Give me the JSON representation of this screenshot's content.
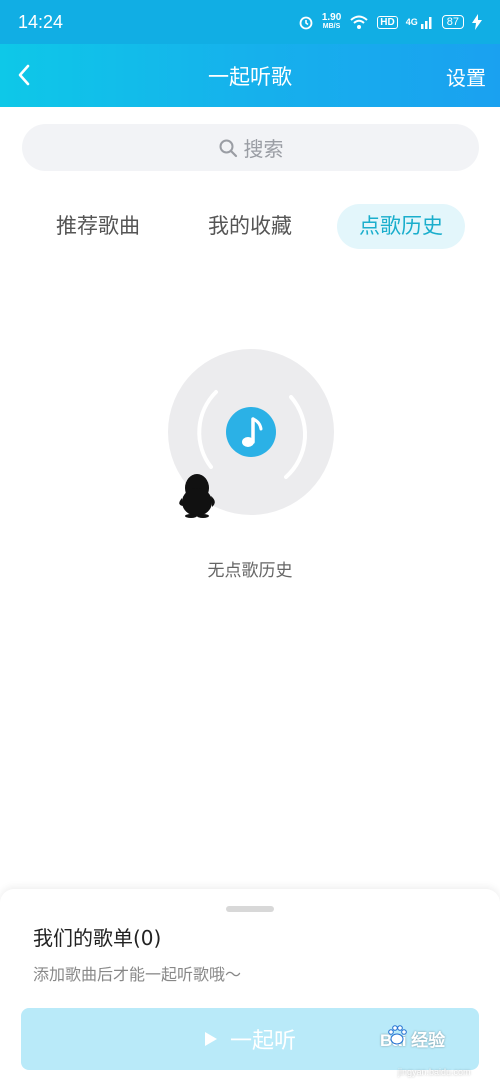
{
  "status_bar": {
    "time": "14:24",
    "speed_value": "1.90",
    "speed_unit": "MB/S",
    "hd_label": "HD",
    "network_label": "4G",
    "battery": "87"
  },
  "nav": {
    "title": "一起听歌",
    "settings_label": "设置",
    "back_icon": "chevron-left-icon"
  },
  "search": {
    "placeholder": "搜索",
    "icon": "search-icon"
  },
  "tabs": [
    {
      "label": "推荐歌曲",
      "active": false
    },
    {
      "label": "我的收藏",
      "active": false
    },
    {
      "label": "点歌历史",
      "active": true
    }
  ],
  "empty_state": {
    "text": "无点歌历史",
    "icon": "music-disc-icon"
  },
  "playlist_sheet": {
    "title": "我们的歌单(0)",
    "subtitle": "添加歌曲后才能一起听歌哦～",
    "button_label": "一起听"
  },
  "watermark": {
    "text": "Bai 经验",
    "url": "jingyan.baidu.com"
  },
  "colors": {
    "accent": "#1aaecc",
    "nav_gradient_start": "#0ec8e8",
    "nav_gradient_end": "#1aa1f0",
    "button_disabled": "#b9eaf9"
  }
}
